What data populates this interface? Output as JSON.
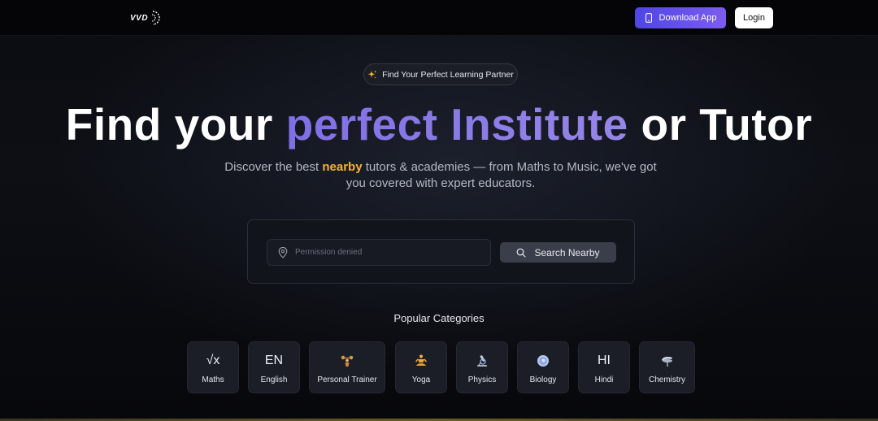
{
  "header": {
    "logo_text": "VVD",
    "download_label": "Download App",
    "login_label": "Login"
  },
  "badge": {
    "text": "Find Your Perfect Learning Partner"
  },
  "hero": {
    "headline_pre": "Find your",
    "headline_accent": "perfect Institute",
    "headline_post": "or Tutor",
    "subtitle_pre": "Discover the best",
    "subtitle_highlight": "nearby",
    "subtitle_post": "tutors & academies — from Maths to Music, we've got you covered with expert educators."
  },
  "search": {
    "placeholder": "Permission denied",
    "button_label": "Search Nearby"
  },
  "categories": {
    "title": "Popular Categories",
    "items": [
      {
        "label": "Maths",
        "icon_text": "√x",
        "icon": "square-root-icon"
      },
      {
        "label": "English",
        "icon_text": "EN",
        "icon": "english-text-icon"
      },
      {
        "label": "Personal Trainer",
        "icon": "dumbbell-icon"
      },
      {
        "label": "Yoga",
        "icon": "yoga-pose-icon"
      },
      {
        "label": "Physics",
        "icon": "microscope-icon"
      },
      {
        "label": "Biology",
        "icon": "cell-icon"
      },
      {
        "label": "Hindi",
        "icon_text": "HI",
        "icon": "hindi-text-icon"
      },
      {
        "label": "Chemistry",
        "icon": "flask-icon"
      }
    ]
  },
  "colors": {
    "accent_purple": "#7f6fe6",
    "highlight_yellow": "#f5b52a",
    "download_gradient": [
      "#4f46e5",
      "#7c5cf0"
    ]
  }
}
